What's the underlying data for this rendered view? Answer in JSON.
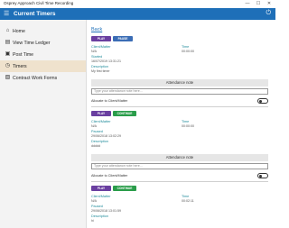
{
  "window": {
    "title": "Osprey Approach Civil Time Recording",
    "controls": [
      "—",
      "☐",
      "✕"
    ]
  },
  "appbar": {
    "menu_icon": "hamburger-icon",
    "title": "Current Timers",
    "power_icon": "power-icon"
  },
  "sidebar": {
    "items": [
      {
        "label": "Home",
        "icon": "home-icon"
      },
      {
        "label": "View Time Ledger",
        "icon": "ledger-icon"
      },
      {
        "label": "Post Time",
        "icon": "post-time-icon"
      },
      {
        "label": "Timers",
        "icon": "timer-icon",
        "active": true
      },
      {
        "label": "Contract Work Forms",
        "icon": "form-icon"
      }
    ]
  },
  "main": {
    "back_label": "Back",
    "labels": {
      "client_matter": "Client/Matter",
      "time": "Time",
      "started": "Started",
      "paused": "Paused",
      "description": "Description",
      "attendance_note": "Attendance note",
      "attendance_placeholder": "Type your attendance note here...",
      "allocate": "Allocate to Client/Matter"
    },
    "timers": [
      {
        "buttons": [
          "PLAY",
          "PAUSE"
        ],
        "client_matter": "N/A",
        "time": "00:00:00",
        "date_label": "Started",
        "date": "16/07/2019 13:31:21",
        "description": "My first timer"
      },
      {
        "buttons": [
          "PLAY",
          "CONTINUE"
        ],
        "client_matter": "N/A",
        "time": "00:00:00",
        "date_label": "Paused",
        "date": "29/06/2018 13:02:29",
        "description": "ddddd"
      },
      {
        "buttons": [
          "PLAY",
          "CONTINUE"
        ],
        "client_matter": "N/A",
        "time": "00:02:11",
        "date_label": "Paused",
        "date": "29/06/2018 13:01:59",
        "description": "hi"
      }
    ]
  }
}
